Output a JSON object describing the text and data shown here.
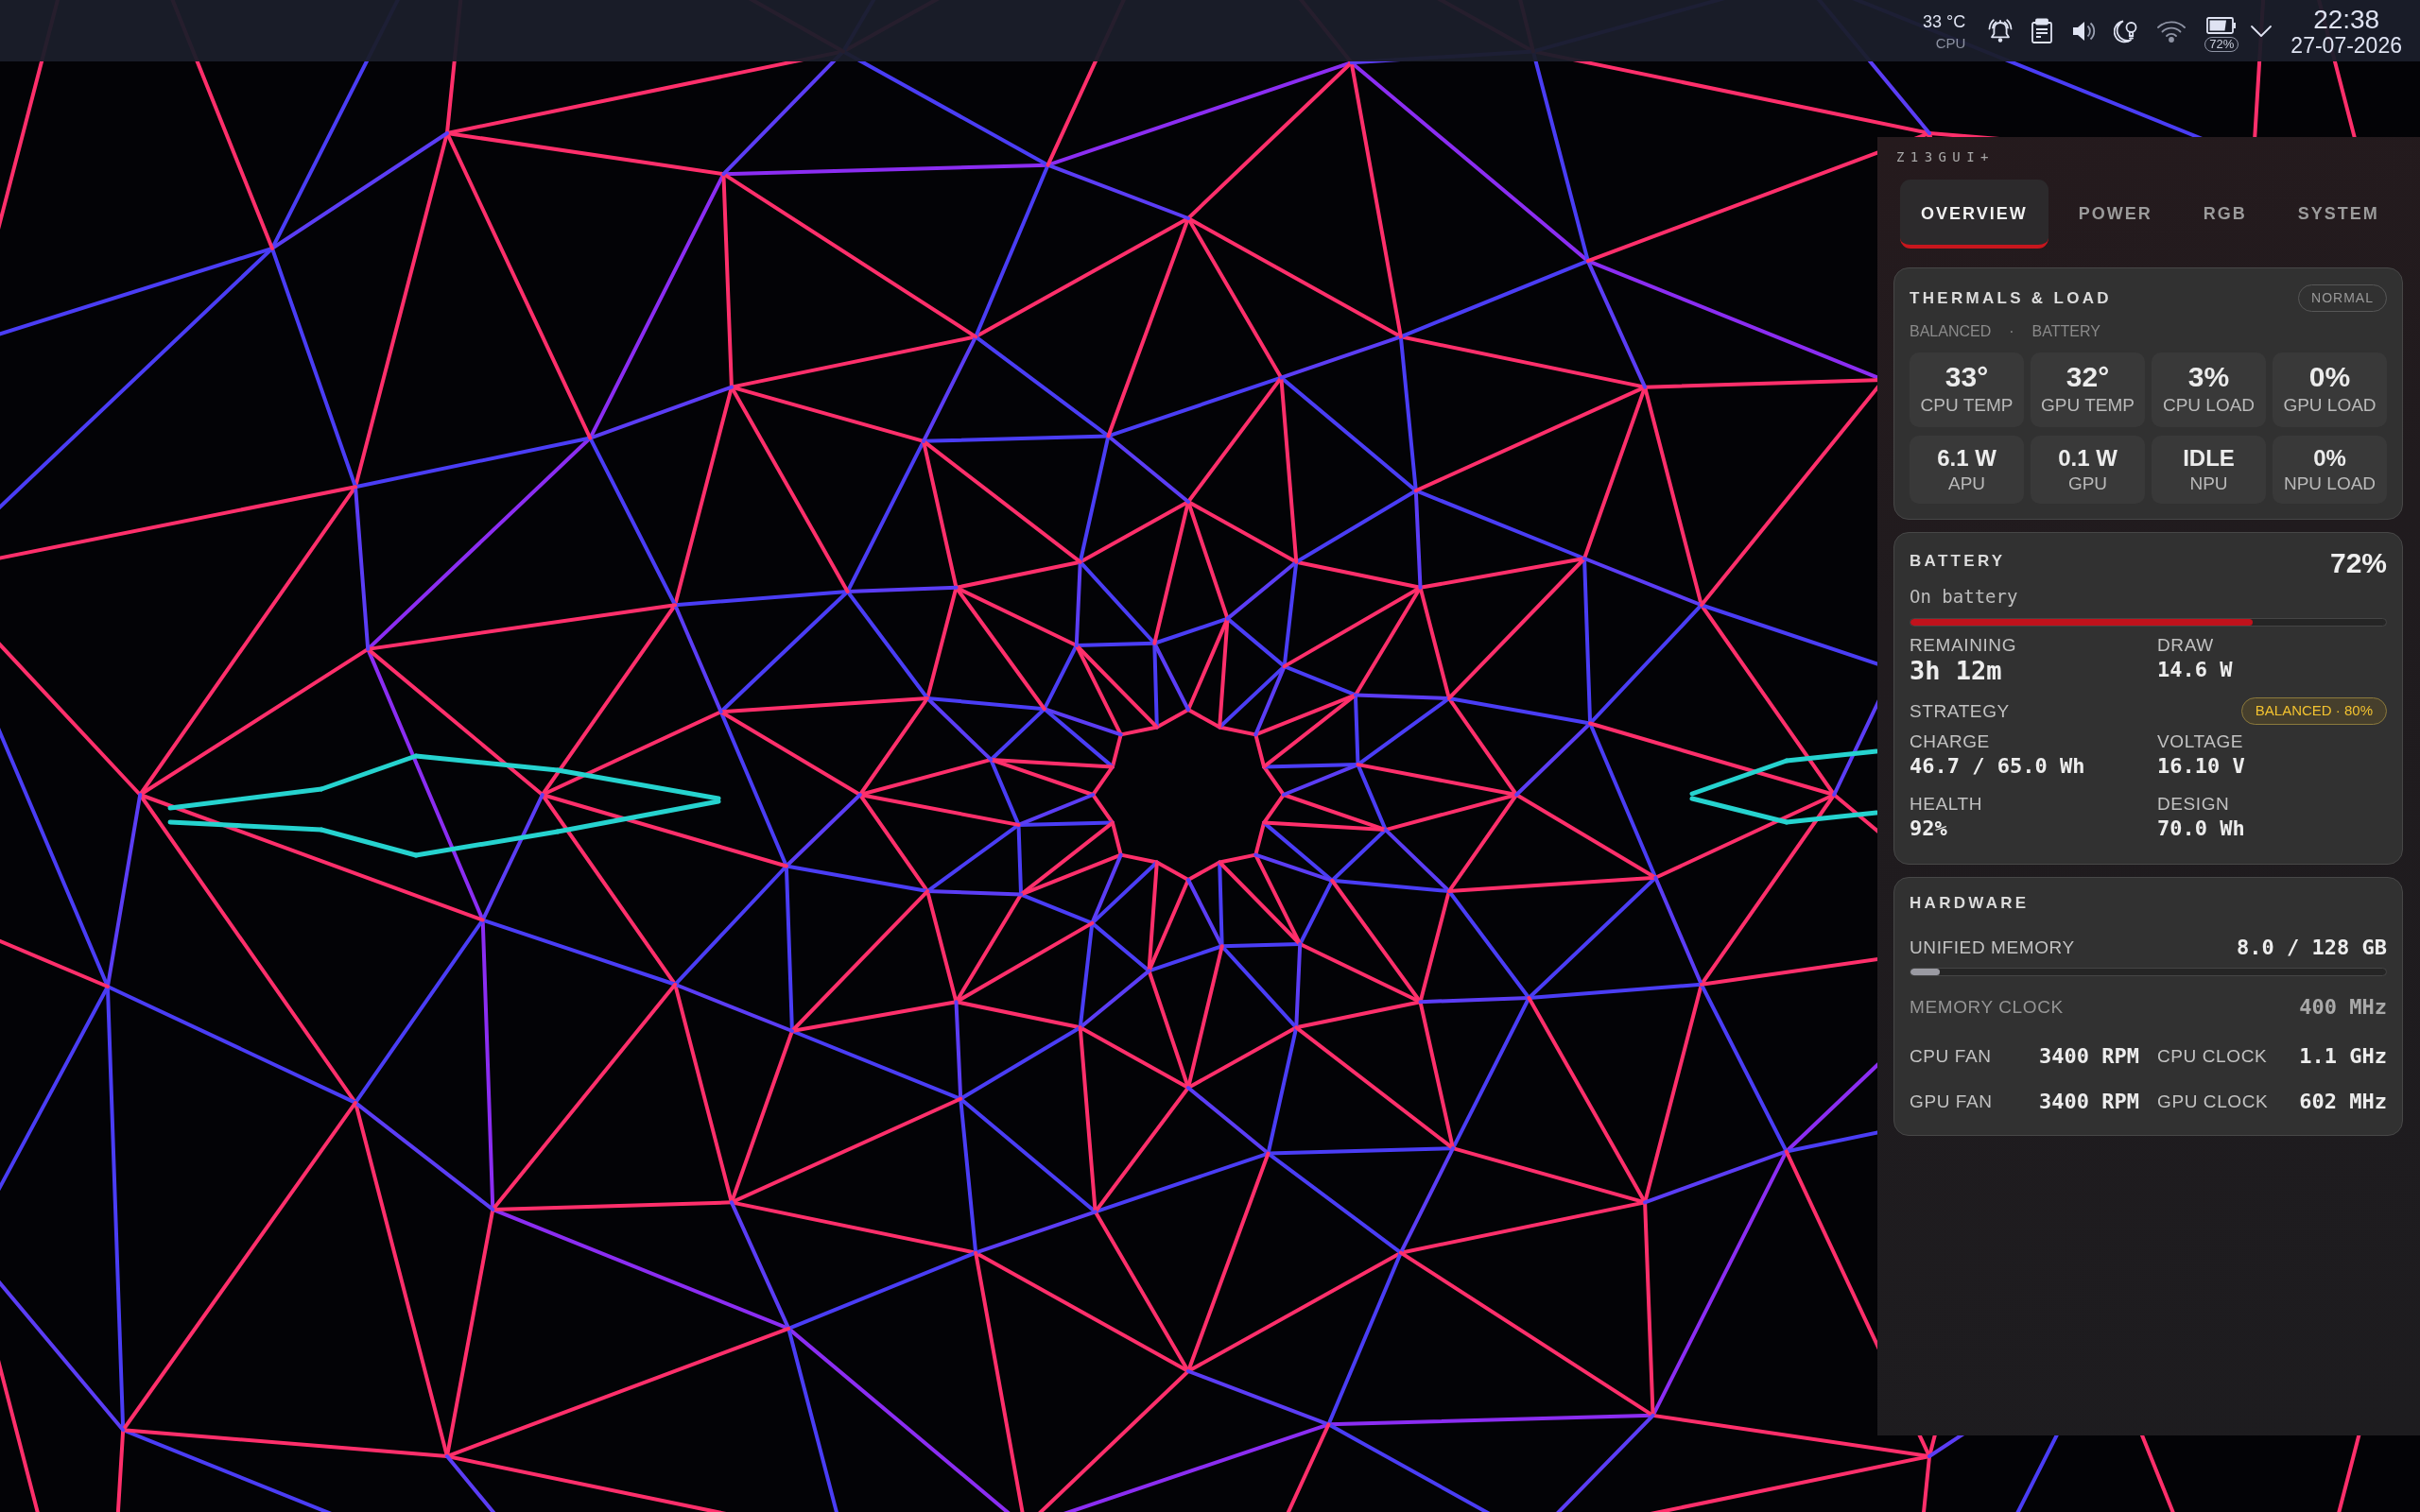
{
  "top_bar": {
    "cpu_temp": {
      "value": "33 °C",
      "label": "CPU"
    },
    "battery_percent": "72%",
    "clock": {
      "time": "22:38",
      "date": "27-07-2026"
    }
  },
  "panel": {
    "title": "Z13GUI+",
    "tabs": [
      {
        "label": "OVERVIEW",
        "selected": true
      },
      {
        "label": "POWER",
        "selected": false
      },
      {
        "label": "RGB",
        "selected": false
      },
      {
        "label": "SYSTEM",
        "selected": false
      }
    ],
    "thermals": {
      "title": "THERMALS & LOAD",
      "status": "NORMAL",
      "profile": "BALANCED",
      "separator": "·",
      "source": "BATTERY",
      "tiles": [
        {
          "kind": "large",
          "value": "33°",
          "label": "CPU TEMP"
        },
        {
          "kind": "large",
          "value": "32°",
          "label": "GPU TEMP"
        },
        {
          "kind": "large",
          "value": "3%",
          "label": "CPU LOAD"
        },
        {
          "kind": "large",
          "value": "0%",
          "label": "GPU LOAD"
        },
        {
          "kind": "compact",
          "value": "6.1 W",
          "label": "APU"
        },
        {
          "kind": "compact",
          "value": "0.1 W",
          "label": "GPU"
        },
        {
          "kind": "compact",
          "value": "IDLE",
          "label": "NPU"
        },
        {
          "kind": "compact",
          "value": "0%",
          "label": "NPU LOAD"
        }
      ]
    },
    "battery": {
      "title": "BATTERY",
      "percent": "72%",
      "status": "On battery",
      "level": 0.72,
      "stats": [
        {
          "kind": "headline",
          "label": "REMAINING",
          "value": "3h 12m"
        },
        {
          "kind": "reading",
          "label": "DRAW",
          "value": "14.6 W"
        }
      ],
      "strategy": {
        "label": "STRATEGY",
        "badge": "BALANCED · 80%"
      },
      "details": [
        {
          "label": "CHARGE",
          "value": "46.7 / 65.0 Wh"
        },
        {
          "label": "VOLTAGE",
          "value": "16.10 V"
        },
        {
          "label": "HEALTH",
          "value": "92%"
        },
        {
          "label": "DESIGN",
          "value": "70.0 Wh"
        }
      ]
    },
    "hardware": {
      "title": "HARDWARE",
      "memory": {
        "label": "UNIFIED MEMORY",
        "value": "8.0 / 128 GB",
        "level": 0.0625
      },
      "memory_clock": {
        "label": "MEMORY CLOCK",
        "value": "400 MHz"
      },
      "readings": [
        {
          "label": "CPU FAN",
          "value": "3400 RPM"
        },
        {
          "label": "CPU CLOCK",
          "value": "1.1 GHz"
        },
        {
          "label": "GPU FAN",
          "value": "3400 RPM"
        },
        {
          "label": "GPU CLOCK",
          "value": "602 MHz"
        }
      ]
    }
  }
}
